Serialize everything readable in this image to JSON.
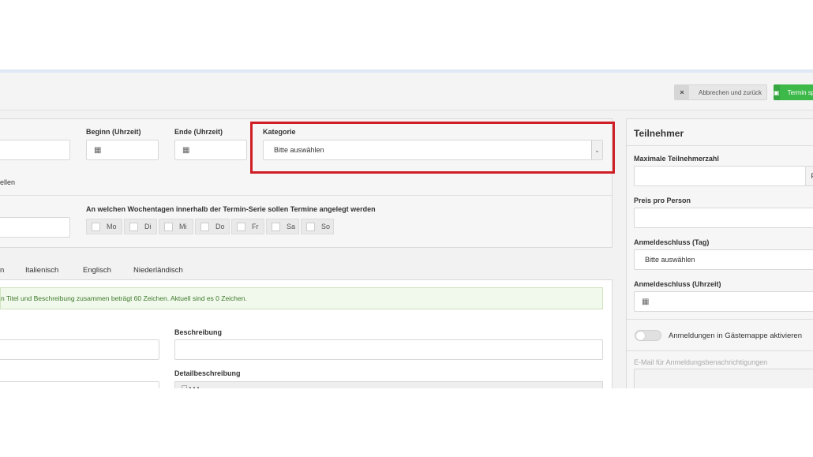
{
  "toolbar": {
    "cancel_icon": "×",
    "cancel_label": "Abbrechen und zurück",
    "save_icon": "▣",
    "save_label": "Termin speichern"
  },
  "top_panel": {
    "beginn_label": "Beginn (Uhrzeit)",
    "ende_label": "Ende (Uhrzeit)",
    "kategorie_label": "Kategorie",
    "kategorie_value": "Bitte auswählen",
    "series_text_fragment": "ellen",
    "weekdays_label": "An welchen Wochentagen innerhalb der Termin-Serie sollen Termine angelegt werden",
    "weekdays": [
      "Mo",
      "Di",
      "Mi",
      "Do",
      "Fr",
      "Sa",
      "So"
    ]
  },
  "language_tabs": {
    "partial_first": "n",
    "tabs": [
      "Italienisch",
      "Englisch",
      "Niederländisch"
    ]
  },
  "info_message": "n Titel und Beschreibung zusammen beträgt 60 Zeichen. Aktuell sind es 0 Zeichen.",
  "content_fields": {
    "beschreibung_label": "Beschreibung",
    "detail_label": "Detailbeschreibung"
  },
  "sidebar": {
    "title": "Teilnehmer",
    "max_label": "Maximale Teilnehmerzahl",
    "max_suffix": "P",
    "preis_label": "Preis pro Person",
    "anmeldeschluss_tag_label": "Anmeldeschluss (Tag)",
    "anmeldeschluss_tag_value": "Bitte auswählen",
    "anmeldeschluss_zeit_label": "Anmeldeschluss (Uhrzeit)",
    "toggle_label": "Anmeldungen in Gästemappe aktivieren",
    "email_label": "E-Mail für Anmeldungsbenachrichtigungen"
  }
}
